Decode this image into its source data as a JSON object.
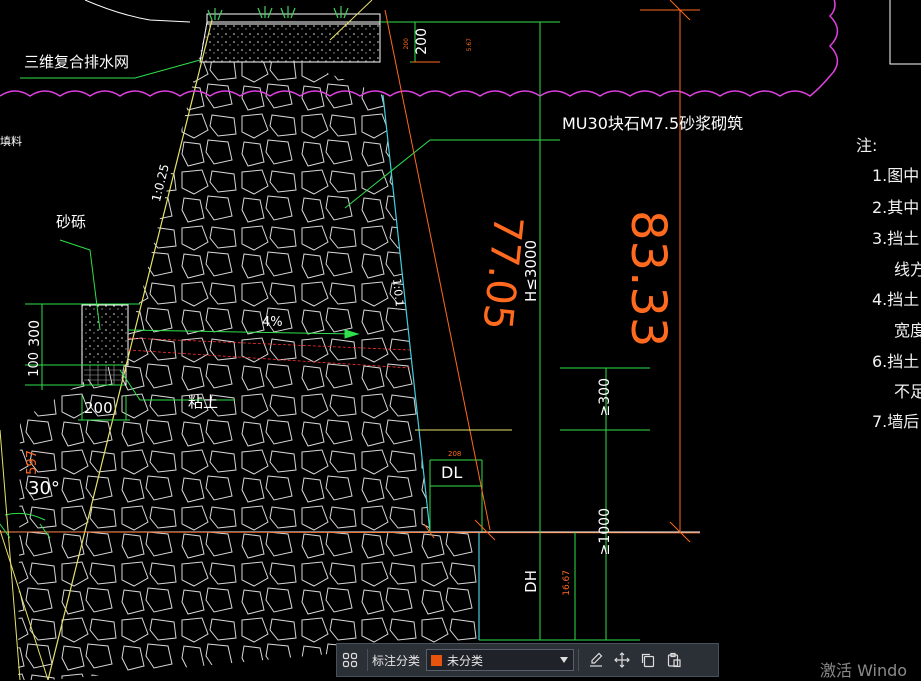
{
  "labels": {
    "drain_net": "三维复合排水网",
    "masonry": "MU30块石M7.5砂浆砌筑",
    "fill": "填料",
    "gravel": "砂砾",
    "clay": "粘土",
    "slope_front": "1:0.25",
    "slope_back": "1:0.1",
    "drain_slope": "4%",
    "angle": "30°",
    "dl": "DL",
    "dh": "DH",
    "height_limit": "H≤3000",
    "min_300": "≥300",
    "min_1000": "≥1000"
  },
  "dimensions": {
    "top_200": "200",
    "top_red_small_1": "200",
    "top_red_small_2": "5.67",
    "left_300": "300",
    "left_100": "100",
    "bottom_200": "200",
    "red_597": "597",
    "red_208": "208",
    "red_1667": "16.67",
    "orange_7705": "77.05",
    "orange_8333": "83.33"
  },
  "notes": {
    "title": "注:",
    "items": [
      "1.图中",
      "2.其中",
      "3.挡土",
      "线方",
      "4.挡土",
      "宽度",
      "6.挡土",
      "不足",
      "7.墙后"
    ]
  },
  "toolbar": {
    "category_label": "标注分类",
    "category_value": "未分类",
    "category_color": "#e8530e"
  },
  "watermark": "激活 Windo"
}
